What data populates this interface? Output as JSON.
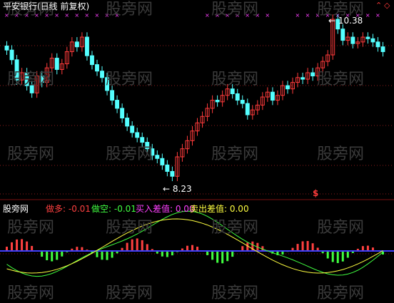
{
  "title": "平安银行(日线 前复权)",
  "max_label": "10.38",
  "min_label": "8.23",
  "signal_symbol": "$",
  "indicator": {
    "name": "股旁网",
    "zuoduo": "做多: -0.01",
    "zuokong": "做空: -0.01",
    "mairu": "买入差值: 0.00",
    "maichu": "卖出差值: 0.00"
  },
  "watermark": "股旁网",
  "controls": {
    "up": "⌃",
    "diamond": "◇"
  },
  "colors": {
    "background": "#000000",
    "up_candle": "#ff3b3b",
    "down_candle": "#54ffff",
    "grid": "#8b1a1a",
    "zuoduo": "#ff4040",
    "zuokong": "#40ff40",
    "mairu": "#ff40ff",
    "maichu": "#ffff40",
    "markers": "#ff40ff"
  },
  "chart_data": {
    "type": "candlestick",
    "price_range": [
      8.23,
      10.38
    ],
    "closes": [
      9.92,
      9.8,
      9.55,
      9.64,
      9.48,
      9.39,
      9.6,
      9.52,
      9.7,
      9.82,
      9.68,
      9.75,
      9.9,
      10.02,
      9.96,
      10.08,
      9.85,
      9.74,
      9.66,
      9.58,
      9.42,
      9.3,
      9.2,
      9.08,
      8.98,
      8.9,
      8.84,
      8.78,
      8.7,
      8.62,
      8.58,
      8.5,
      8.42,
      8.36,
      8.6,
      8.7,
      8.8,
      8.92,
      9.02,
      9.1,
      9.2,
      9.3,
      9.28,
      9.36,
      9.44,
      9.38,
      9.3,
      9.26,
      9.12,
      9.18,
      9.24,
      9.34,
      9.4,
      9.3,
      9.36,
      9.48,
      9.44,
      9.52,
      9.58,
      9.56,
      9.64,
      9.6,
      9.7,
      9.78,
      9.86,
      10.3,
      10.18,
      10.04,
      10.08,
      10.0,
      10.02,
      10.08,
      10.06,
      10.02,
      9.96,
      9.9
    ],
    "indicator_lines": {
      "zuoduo_label": "做多",
      "zuokong_label": "做空",
      "mairu_label": "买入差值",
      "maichu_label": "卖出差值"
    }
  }
}
